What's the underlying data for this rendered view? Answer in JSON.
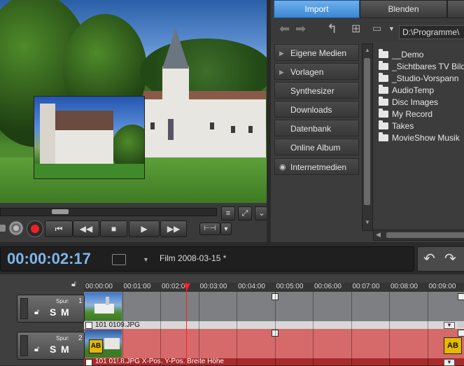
{
  "tabs": {
    "import": "Import",
    "blenden": "Blenden"
  },
  "path": "D:\\Programme\\",
  "categories": [
    "Eigene Medien",
    "Vorlagen",
    "Synthesizer",
    "Downloads",
    "Datenbank",
    "Online Album",
    "Internetmedien"
  ],
  "folders": [
    "__Demo",
    "_Sichtbares TV Bild",
    "_Studio-Vorspann",
    "AudioTemp",
    "Disc Images",
    "My Record",
    "Takes",
    "MovieShow Musik"
  ],
  "timecode": "00:00:02:17",
  "film_name": "Film 2008-03-15 *",
  "ruler": [
    "00:00:00",
    "00:01:00",
    "00:02:0",
    "00:03:00",
    "00:04:00",
    "00:05:00",
    "00:06:00",
    "00:07:00",
    "00:08:00",
    "00:09:00"
  ],
  "tracks": [
    {
      "spur_label": "Spur:",
      "number": "1",
      "s": "S",
      "m": "M",
      "clip_label": "101  0109.JPG"
    },
    {
      "spur_label": "Spur:",
      "number": "2",
      "s": "S",
      "m": "M",
      "clip_label": "101  01!.8.JPG  X-Pos.  Y-Pos.  Breite  Höhe"
    }
  ],
  "badges": {
    "ab": "AB"
  },
  "colors": {
    "timecode": "#7fb6ea",
    "playhead": "#ff2020",
    "tab_active": "#4a8fd6",
    "track2": "#d66a6a"
  }
}
